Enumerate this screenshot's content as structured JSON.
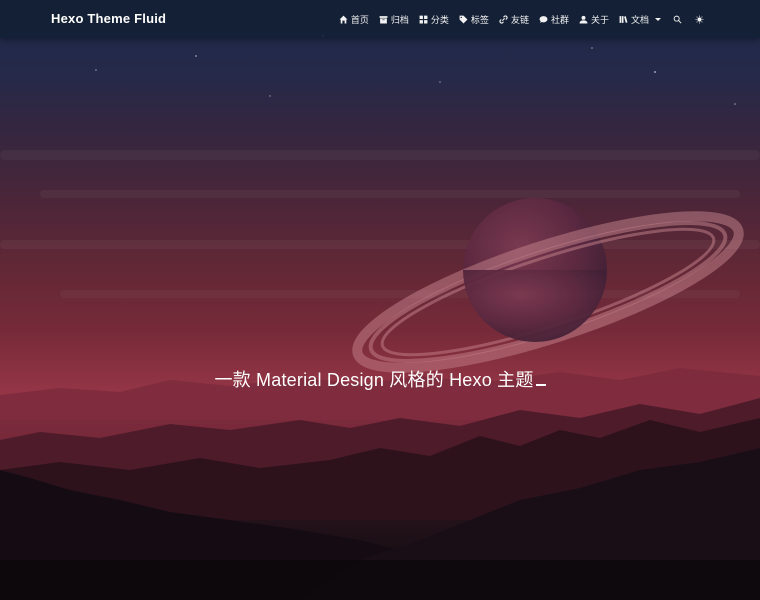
{
  "navbar": {
    "brand": "Hexo Theme Fluid",
    "items": [
      {
        "label": "首页",
        "icon": "home-icon"
      },
      {
        "label": "归档",
        "icon": "archive-icon"
      },
      {
        "label": "分类",
        "icon": "category-icon"
      },
      {
        "label": "标签",
        "icon": "tag-icon"
      },
      {
        "label": "友链",
        "icon": "link-icon"
      },
      {
        "label": "社群",
        "icon": "chat-icon"
      },
      {
        "label": "关于",
        "icon": "user-icon"
      },
      {
        "label": "文档",
        "icon": "book-icon",
        "dropdown": true
      }
    ],
    "search_icon": "search-icon",
    "theme_toggle_icon": "sun-icon"
  },
  "hero": {
    "slogan": "一款 Material Design 风格的 Hexo 主题"
  },
  "colors": {
    "navbar": "#141f34",
    "sky_top": "#1c2a48",
    "sky_mid": "#7b2b3a",
    "mountain_dark": "#0e0a0e"
  }
}
